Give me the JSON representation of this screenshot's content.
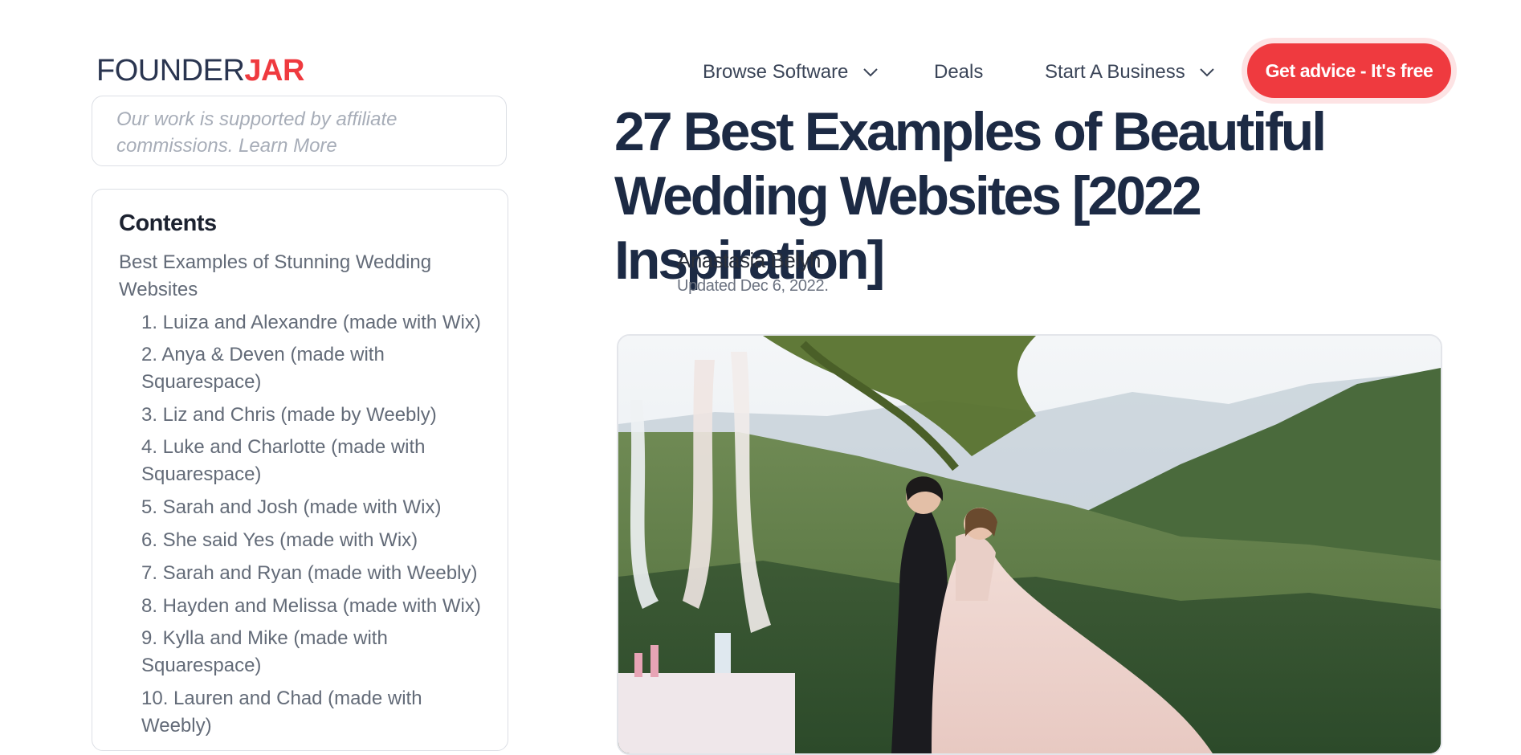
{
  "logo": {
    "part1": "FOUNDER",
    "part2": "JAR"
  },
  "nav": {
    "browse": "Browse Software",
    "deals": "Deals",
    "start": "Start A Business",
    "cta": "Get advice - It's free"
  },
  "affiliate": {
    "line1": "Our work is supported by affiliate",
    "line2": "commissions. Learn More"
  },
  "toc": {
    "title": "Contents",
    "section_line1": "Best Examples of Stunning Wedding",
    "section_line2": "Websites",
    "items": {
      "i1": "1. Luiza and Alexandre (made with Wix)",
      "i2a": "2. Anya & Deven (made with",
      "i2b": "Squarespace)",
      "i3": "3. Liz and Chris (made by Weebly)",
      "i4a": "4. Luke and Charlotte (made with",
      "i4b": "Squarespace)",
      "i5": "5. Sarah and Josh (made with Wix)",
      "i6": "6. She said Yes (made with Wix)",
      "i7": "7. Sarah and Ryan (made with Weebly)",
      "i8": "8. Hayden and Melissa (made with Wix)",
      "i9a": "9. Kylla and Mike (made with",
      "i9b": "Squarespace)",
      "i10a": "10. Lauren and Chad (made with",
      "i10b": "Weebly)"
    }
  },
  "article": {
    "title_line1": "27 Best Examples of Beautiful",
    "title_line2": "Wedding Websites [2022 Inspiration]",
    "author": "Anastasia Belyh",
    "updated": "Updated Dec 6, 2022."
  },
  "colors": {
    "brand": "#ef3a3f",
    "heading": "#1c2a44"
  },
  "icons": {
    "dropdown": "chevron-down-icon"
  }
}
